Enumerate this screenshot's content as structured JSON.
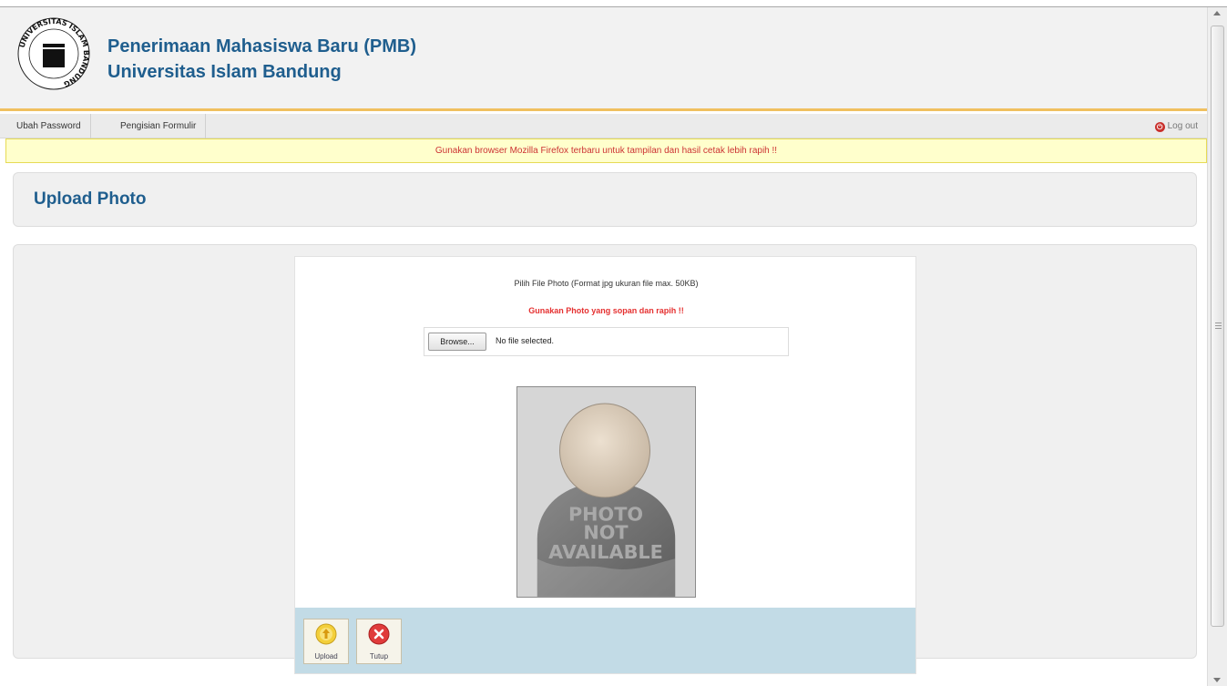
{
  "header": {
    "logo_ring_text": "UNIVERSITAS ISLAM BANDUNG",
    "title_line1": "Penerimaan Mahasiswa Baru (PMB)",
    "title_line2": "Universitas Islam Bandung"
  },
  "menu": {
    "items": [
      {
        "label": "Ubah Password"
      },
      {
        "label": "Pengisian Formulir"
      }
    ],
    "logout_label": "Log out"
  },
  "notice": {
    "text": "Gunakan browser Mozilla Firefox terbaru untuk tampilan dan hasil cetak lebih rapih !!"
  },
  "page": {
    "title": "Upload Photo"
  },
  "upload": {
    "instruction": "Pilih File Photo (Format jpg ukuran file max. 50KB)",
    "warning": "Gunakan Photo yang sopan dan rapih !!",
    "browse_label": "Browse...",
    "file_status": "No file selected.",
    "placeholder_text_line1": "PHOTO",
    "placeholder_text_line2": "NOT",
    "placeholder_text_line3": "AVAILABLE"
  },
  "actions": {
    "upload_label": "Upload",
    "close_label": "Tutup"
  },
  "colors": {
    "brand_blue": "#1f5e8e",
    "header_accent": "#f0c060",
    "warning_red": "#e53030",
    "action_bar": "#c2dbe6"
  }
}
